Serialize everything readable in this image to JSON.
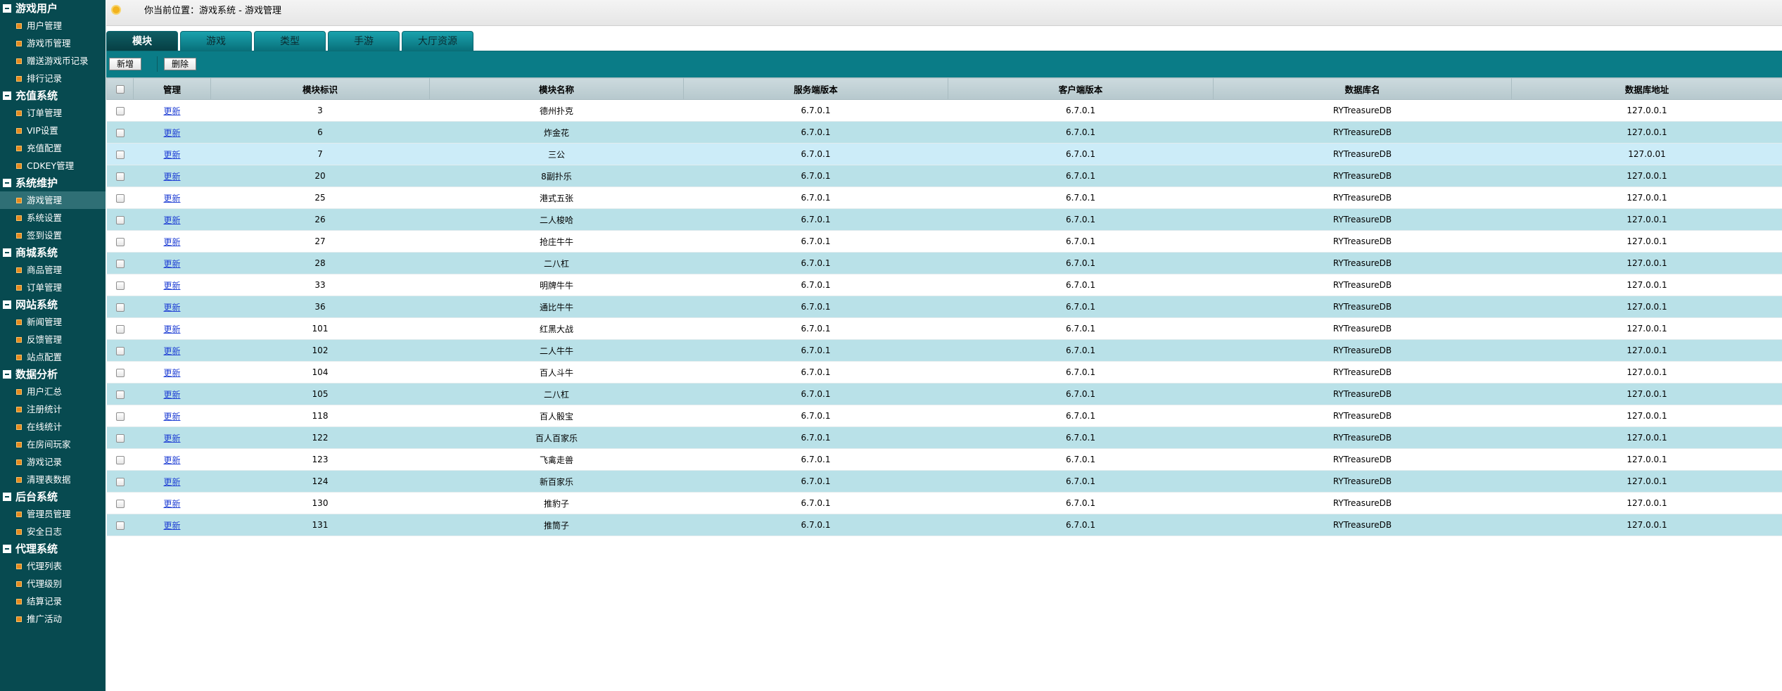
{
  "sidebar": {
    "groups": [
      {
        "title": "游戏用户",
        "items": [
          "用户管理",
          "游戏币管理",
          "赠送游戏币记录",
          "排行记录"
        ]
      },
      {
        "title": "充值系统",
        "items": [
          "订单管理",
          "VIP设置",
          "充值配置",
          "CDKEY管理"
        ]
      },
      {
        "title": "系统维护",
        "items": [
          "游戏管理",
          "系统设置",
          "签到设置"
        ]
      },
      {
        "title": "商城系统",
        "items": [
          "商品管理",
          "订单管理"
        ]
      },
      {
        "title": "网站系统",
        "items": [
          "新闻管理",
          "反馈管理",
          "站点配置"
        ]
      },
      {
        "title": "数据分析",
        "items": [
          "用户汇总",
          "注册统计",
          "在线统计",
          "在房间玩家",
          "游戏记录",
          "清理表数据"
        ]
      },
      {
        "title": "后台系统",
        "items": [
          "管理员管理",
          "安全日志"
        ]
      },
      {
        "title": "代理系统",
        "items": [
          "代理列表",
          "代理级别",
          "结算记录",
          "推广活动"
        ]
      }
    ],
    "active_group": 2,
    "active_item": 0
  },
  "breadcrumb": "你当前位置：游戏系统 - 游戏管理",
  "tabs": [
    "模块",
    "游戏",
    "类型",
    "手游",
    "大厅资源"
  ],
  "active_tab": 0,
  "toolbar": {
    "add_label": "新增",
    "delete_label": "删除"
  },
  "table": {
    "headers": [
      "管理",
      "模块标识",
      "模块名称",
      "服务端版本",
      "客户端版本",
      "数据库名",
      "数据库地址"
    ],
    "hover_row": 2,
    "rows": [
      {
        "action": "更新",
        "id": "3",
        "name": "德州扑克",
        "server": "6.7.0.1",
        "client": "6.7.0.1",
        "db": "RYTreasureDB",
        "addr": "127.0.0.1"
      },
      {
        "action": "更新",
        "id": "6",
        "name": "炸金花",
        "server": "6.7.0.1",
        "client": "6.7.0.1",
        "db": "RYTreasureDB",
        "addr": "127.0.0.1"
      },
      {
        "action": "更新",
        "id": "7",
        "name": "三公",
        "server": "6.7.0.1",
        "client": "6.7.0.1",
        "db": "RYTreasureDB",
        "addr": "127.0.01"
      },
      {
        "action": "更新",
        "id": "20",
        "name": "8副扑乐",
        "server": "6.7.0.1",
        "client": "6.7.0.1",
        "db": "RYTreasureDB",
        "addr": "127.0.0.1"
      },
      {
        "action": "更新",
        "id": "25",
        "name": "港式五张",
        "server": "6.7.0.1",
        "client": "6.7.0.1",
        "db": "RYTreasureDB",
        "addr": "127.0.0.1"
      },
      {
        "action": "更新",
        "id": "26",
        "name": "二人梭哈",
        "server": "6.7.0.1",
        "client": "6.7.0.1",
        "db": "RYTreasureDB",
        "addr": "127.0.0.1"
      },
      {
        "action": "更新",
        "id": "27",
        "name": "抢庄牛牛",
        "server": "6.7.0.1",
        "client": "6.7.0.1",
        "db": "RYTreasureDB",
        "addr": "127.0.0.1"
      },
      {
        "action": "更新",
        "id": "28",
        "name": "二八杠",
        "server": "6.7.0.1",
        "client": "6.7.0.1",
        "db": "RYTreasureDB",
        "addr": "127.0.0.1"
      },
      {
        "action": "更新",
        "id": "33",
        "name": "明牌牛牛",
        "server": "6.7.0.1",
        "client": "6.7.0.1",
        "db": "RYTreasureDB",
        "addr": "127.0.0.1"
      },
      {
        "action": "更新",
        "id": "36",
        "name": "通比牛牛",
        "server": "6.7.0.1",
        "client": "6.7.0.1",
        "db": "RYTreasureDB",
        "addr": "127.0.0.1"
      },
      {
        "action": "更新",
        "id": "101",
        "name": "红黑大战",
        "server": "6.7.0.1",
        "client": "6.7.0.1",
        "db": "RYTreasureDB",
        "addr": "127.0.0.1"
      },
      {
        "action": "更新",
        "id": "102",
        "name": "二人牛牛",
        "server": "6.7.0.1",
        "client": "6.7.0.1",
        "db": "RYTreasureDB",
        "addr": "127.0.0.1"
      },
      {
        "action": "更新",
        "id": "104",
        "name": "百人斗牛",
        "server": "6.7.0.1",
        "client": "6.7.0.1",
        "db": "RYTreasureDB",
        "addr": "127.0.0.1"
      },
      {
        "action": "更新",
        "id": "105",
        "name": "二八杠",
        "server": "6.7.0.1",
        "client": "6.7.0.1",
        "db": "RYTreasureDB",
        "addr": "127.0.0.1"
      },
      {
        "action": "更新",
        "id": "118",
        "name": "百人骰宝",
        "server": "6.7.0.1",
        "client": "6.7.0.1",
        "db": "RYTreasureDB",
        "addr": "127.0.0.1"
      },
      {
        "action": "更新",
        "id": "122",
        "name": "百人百家乐",
        "server": "6.7.0.1",
        "client": "6.7.0.1",
        "db": "RYTreasureDB",
        "addr": "127.0.0.1"
      },
      {
        "action": "更新",
        "id": "123",
        "name": "飞禽走兽",
        "server": "6.7.0.1",
        "client": "6.7.0.1",
        "db": "RYTreasureDB",
        "addr": "127.0.0.1"
      },
      {
        "action": "更新",
        "id": "124",
        "name": "新百家乐",
        "server": "6.7.0.1",
        "client": "6.7.0.1",
        "db": "RYTreasureDB",
        "addr": "127.0.0.1"
      },
      {
        "action": "更新",
        "id": "130",
        "name": "推豹子",
        "server": "6.7.0.1",
        "client": "6.7.0.1",
        "db": "RYTreasureDB",
        "addr": "127.0.0.1"
      },
      {
        "action": "更新",
        "id": "131",
        "name": "推筒子",
        "server": "6.7.0.1",
        "client": "6.7.0.1",
        "db": "RYTreasureDB",
        "addr": "127.0.0.1"
      }
    ]
  },
  "colors": {
    "sidebar_bg": "#074a50",
    "tab_bg": "#08707a",
    "toolbar_bg": "#0a7c87",
    "row_alt": "#b9e1e8",
    "row_hover": "#ccecf8",
    "link": "#1f3fd4",
    "bullet": "#e58a1f"
  }
}
